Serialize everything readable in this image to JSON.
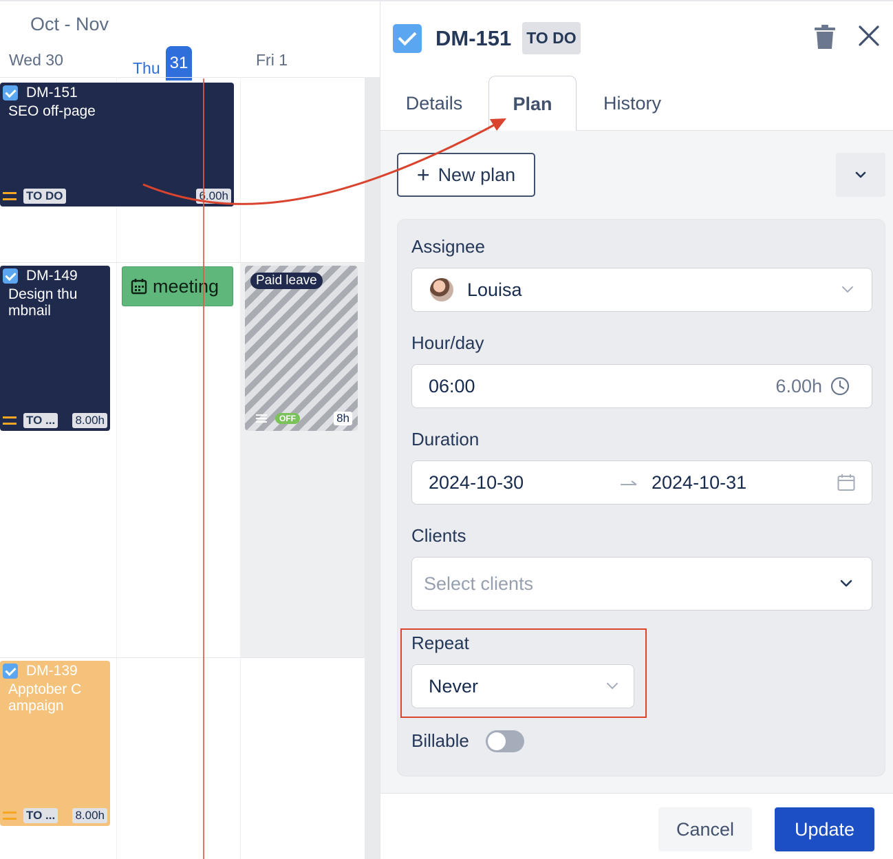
{
  "calendar": {
    "range": "Oct - Nov",
    "days": [
      {
        "name": "Wed",
        "num": "30"
      },
      {
        "name": "Thu",
        "num": "31"
      },
      {
        "name": "Fri",
        "num": "1"
      }
    ],
    "tasks": [
      {
        "key": "DM-151",
        "title": "SEO off-page",
        "status": "TO DO",
        "hours": "6.00h"
      },
      {
        "key": "DM-149",
        "title": "Design thu mbnail",
        "status": "TO ...",
        "hours": "8.00h"
      },
      {
        "key": "DM-139",
        "title": "Apptober C ampaign",
        "status": "TO ...",
        "hours": "8.00h"
      }
    ],
    "meeting": {
      "label": "meeting",
      "icon": "calendar-icon"
    },
    "leave": {
      "label": "Paid leave",
      "badge": "OFF",
      "hours": "8h"
    }
  },
  "panel": {
    "key": "DM-151",
    "status": "TO DO",
    "tabs": [
      "Details",
      "Plan",
      "History"
    ],
    "active_tab": "Plan",
    "new_plan_label": "New plan",
    "form": {
      "assignee_label": "Assignee",
      "assignee_value": "Louisa",
      "hourday_label": "Hour/day",
      "hourday_value": "06:00",
      "hourday_hint": "6.00h",
      "duration_label": "Duration",
      "duration_start": "2024-10-30",
      "duration_end": "2024-10-31",
      "clients_label": "Clients",
      "clients_placeholder": "Select clients",
      "repeat_label": "Repeat",
      "repeat_value": "Never",
      "billable_label": "Billable",
      "billable_on": false
    },
    "cancel_label": "Cancel",
    "update_label": "Update"
  },
  "colors": {
    "accent": "#1d4fc4",
    "today": "#2f6fdb",
    "task_dark": "#1f2a4d",
    "task_orange": "#f5c27b",
    "meeting": "#5fb77b",
    "annotation": "#d9442f"
  },
  "icons": [
    "check-icon",
    "trash-icon",
    "close-icon",
    "plus-icon",
    "chevron-down-icon",
    "clock-icon",
    "calendar-icon",
    "arrow-right-icon",
    "priority-icon",
    "menu-icon"
  ]
}
